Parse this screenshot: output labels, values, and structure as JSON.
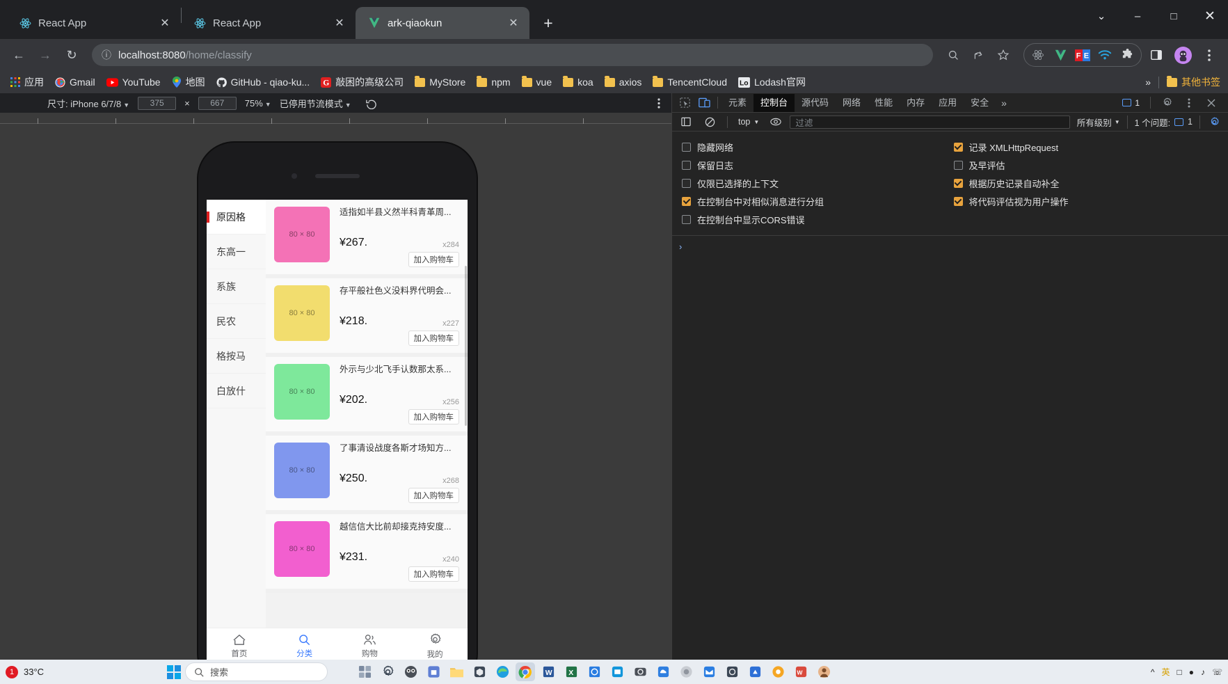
{
  "browser": {
    "tabs": [
      {
        "title": "React App",
        "icon": "react-icon",
        "active": false
      },
      {
        "title": "React App",
        "icon": "react-icon",
        "active": false
      },
      {
        "title": "ark-qiaokun",
        "icon": "vue-icon",
        "active": true
      }
    ],
    "new_tab_label": "+",
    "window_controls": {
      "history": "⌄",
      "minimize": "–",
      "maximize": "□",
      "close": "✕"
    },
    "nav": {
      "back": "←",
      "forward": "→",
      "reload": "↻",
      "info": "ⓘ"
    },
    "omnibox": {
      "url_host": "localhost:8080",
      "url_path": "/home/classify",
      "full_url": "localhost:8080/home/classify"
    },
    "omnibox_actions": [
      "search-icon",
      "share-icon",
      "bookmark-star-icon"
    ],
    "extensions": [
      "react-devtools-icon",
      "vue-devtools-icon",
      "fe-helper-icon",
      "wifi-icon",
      "puzzle-icon"
    ],
    "side_panel_icon": "side-panel-icon",
    "profile_icon": "profile-avatar",
    "menu_icon": "three-dot-menu-icon",
    "bookmarks": [
      {
        "label": "应用",
        "icon": "apps-grid-icon"
      },
      {
        "label": "Gmail",
        "icon": "gmail-icon"
      },
      {
        "label": "YouTube",
        "icon": "youtube-icon"
      },
      {
        "label": "地图",
        "icon": "maps-icon"
      },
      {
        "label": "GitHub - qiao-ku...",
        "icon": "github-icon"
      },
      {
        "label": "敲困的高级公司",
        "icon": "g-red-icon"
      },
      {
        "label": "MyStore",
        "icon": "folder-icon"
      },
      {
        "label": "npm",
        "icon": "folder-icon"
      },
      {
        "label": "vue",
        "icon": "folder-icon"
      },
      {
        "label": "koa",
        "icon": "folder-icon"
      },
      {
        "label": "axios",
        "icon": "folder-icon"
      },
      {
        "label": "TencentCloud",
        "icon": "folder-icon"
      },
      {
        "label": "Lodash官网",
        "icon": "lodash-icon"
      }
    ],
    "bookmarks_overflow": "»",
    "other_bookmarks": "其他书签"
  },
  "device_toolbar": {
    "size_label": "尺寸: iPhone 6/7/8",
    "width": "375",
    "times": "×",
    "height": "667",
    "zoom": "75%",
    "throttling": "已停用节流模式",
    "rotate_icon": "rotate-device-icon",
    "more_icon": "three-dot-menu-icon"
  },
  "app": {
    "categories": [
      {
        "label": "原因格",
        "active": true
      },
      {
        "label": "东高一",
        "active": false
      },
      {
        "label": "系族",
        "active": false
      },
      {
        "label": "民农",
        "active": false
      },
      {
        "label": "格按马",
        "active": false
      },
      {
        "label": "白放什",
        "active": false
      }
    ],
    "image_placeholder": "80 × 80",
    "cart_button": "加入购物车",
    "goods": [
      {
        "title": "适指如半县义然半科青革周...",
        "price": "¥267.",
        "stock": "x284",
        "color": "#f472b6"
      },
      {
        "title": "存平般社色义没料界代明会...",
        "price": "¥218.",
        "stock": "x227",
        "color": "#f2dd6e"
      },
      {
        "title": "外示与少北飞手认数那太系...",
        "price": "¥202.",
        "stock": "x256",
        "color": "#7ee89b"
      },
      {
        "title": "了事清设战度各斯才场知方...",
        "price": "¥250.",
        "stock": "x268",
        "color": "#8097ee"
      },
      {
        "title": "越信信大比前却接克持安度...",
        "price": "¥231.",
        "stock": "x240",
        "color": "#f25fcf"
      }
    ],
    "tabbar": [
      {
        "label": "首页",
        "icon": "home-icon",
        "active": false
      },
      {
        "label": "分类",
        "icon": "search-icon",
        "active": true
      },
      {
        "label": "购物",
        "icon": "user-group-icon",
        "active": false
      },
      {
        "label": "我的",
        "icon": "gear-icon",
        "active": false
      }
    ]
  },
  "devtools": {
    "inspect_icon": "inspect-element-icon",
    "device_toggle_icon": "device-toolbar-icon",
    "tabs": [
      {
        "label": "元素",
        "active": false
      },
      {
        "label": "控制台",
        "active": true
      },
      {
        "label": "源代码",
        "active": false
      },
      {
        "label": "网络",
        "active": false
      },
      {
        "label": "性能",
        "active": false
      },
      {
        "label": "内存",
        "active": false
      },
      {
        "label": "应用",
        "active": false
      },
      {
        "label": "安全",
        "active": false
      }
    ],
    "overflow": "»",
    "message_count": "1",
    "settings_icon": "gear-icon",
    "dock_menu_icon": "three-dot-menu-icon",
    "close_icon": "close-icon",
    "filterbar": {
      "sidebar_icon": "console-sidebar-icon",
      "clear_icon": "clear-console-icon",
      "context": "top",
      "eye_icon": "live-expression-icon",
      "filter_placeholder": "过滤",
      "level": "所有级别",
      "issues_label": "1 个问题:",
      "issues_count": "1",
      "settings_icon": "gear-icon"
    },
    "settings_left": [
      {
        "label": "隐藏网络",
        "checked": false
      },
      {
        "label": "保留日志",
        "checked": false
      },
      {
        "label": "仅限已选择的上下文",
        "checked": false
      },
      {
        "label": "在控制台中对相似消息进行分组",
        "checked": true
      },
      {
        "label": "在控制台中显示CORS错误",
        "checked": false
      }
    ],
    "settings_right": [
      {
        "label": "记录 XMLHttpRequest",
        "checked": true
      },
      {
        "label": "及早评估",
        "checked": false
      },
      {
        "label": "根据历史记录自动补全",
        "checked": true
      },
      {
        "label": "将代码评估视为用户操作",
        "checked": true
      }
    ],
    "prompt_symbol": "›"
  },
  "taskbar": {
    "weather_badge": "1",
    "weather_temp": "33°C",
    "search_placeholder": "搜索",
    "start_icon": "windows-start-icon"
  },
  "colors": {
    "accent_blue": "#3a7afe",
    "active_red": "#e02020",
    "checkbox_orange": "#e8a33d",
    "devtools_bg": "#242424",
    "browser_chrome": "#35363a"
  }
}
